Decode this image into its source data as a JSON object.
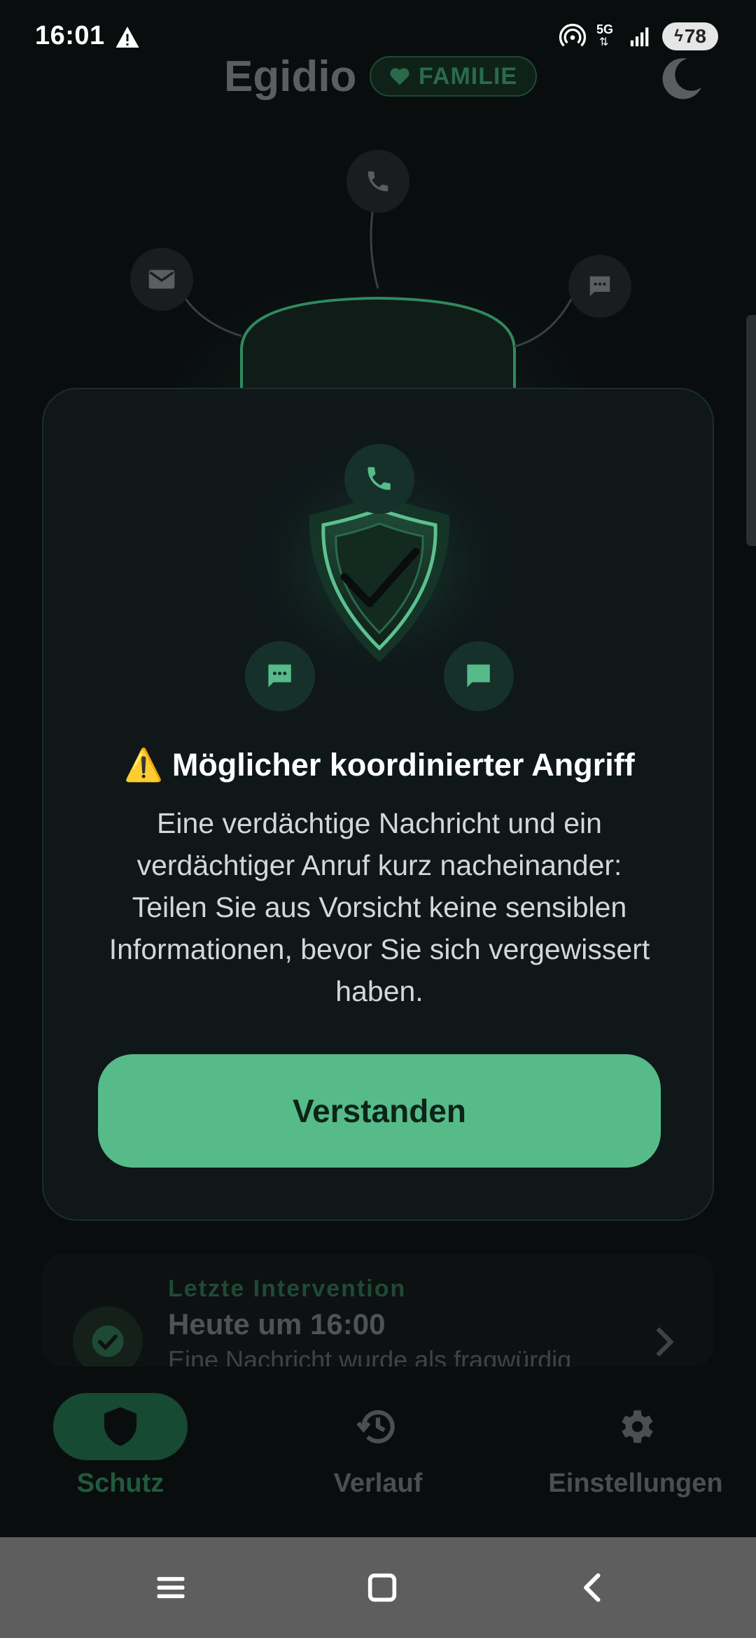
{
  "status_bar": {
    "time": "16:01",
    "network": "5G",
    "battery": "78",
    "icons": [
      "warning-icon",
      "hotspot-icon",
      "signal-icon",
      "battery-charging-icon"
    ]
  },
  "header": {
    "app_title": "Egidio",
    "badge_label": "FAMILIE",
    "badge_icon": "heart-icon",
    "theme_icon": "moon-icon"
  },
  "dialog": {
    "title": "⚠️ Möglicher koordinierter Angriff",
    "body": "Eine verdächtige Nachricht und ein verdächtiger Anruf kurz nacheinander: Teilen Sie aus Vorsicht keine sensiblen Informationen, bevor Sie sich vergewissert haben.",
    "button_label": "Verstanden",
    "icons": [
      "phone-icon",
      "shield-check-icon",
      "sms-icon",
      "chat-icon"
    ]
  },
  "last_intervention": {
    "kicker": "Letzte Intervention",
    "heading": "Heute um 16:00",
    "subtext": "Eine Nachricht wurde als fragwürdig"
  },
  "bottom_nav": {
    "items": [
      {
        "label": "Schutz",
        "icon": "shield-icon",
        "active": true
      },
      {
        "label": "Verlauf",
        "icon": "history-icon",
        "active": false
      },
      {
        "label": "Einstellungen",
        "icon": "gear-icon",
        "active": false
      }
    ]
  },
  "colors": {
    "accent": "#56bb89",
    "background": "#0a0d0e",
    "dialog": "#0f1719"
  }
}
